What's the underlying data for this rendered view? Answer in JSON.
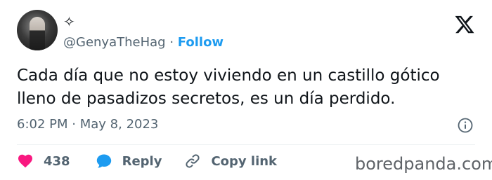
{
  "author": {
    "display_name": "✧",
    "handle": "@GenyaTheHag",
    "separator": "·",
    "follow_label": "Follow"
  },
  "tweet": {
    "text_line1": "Cada día que no estoy viviendo en un castillo gótico",
    "text_line2": "lleno de pasadizos secretos, es un día perdido.",
    "time": "6:02 PM",
    "date_separator": "·",
    "date": "May 8, 2023"
  },
  "actions": {
    "like_count": "438",
    "reply_label": "Reply",
    "copy_link_label": "Copy link"
  },
  "watermark": "boredpanda.com",
  "icons": {
    "brand": "x-logo-icon",
    "info": "info-icon",
    "like": "heart-icon",
    "reply": "speech-bubble-icon",
    "copy": "link-icon"
  },
  "colors": {
    "text": "#0f1419",
    "secondary": "#536471",
    "accent": "#1d9bf0",
    "like": "#f91880"
  }
}
